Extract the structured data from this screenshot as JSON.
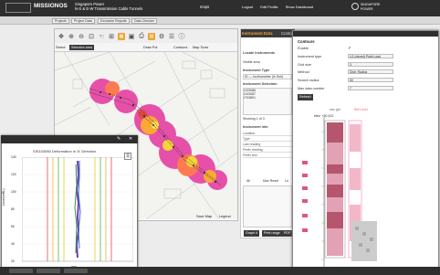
{
  "header": {
    "brand": "MISSIONOS",
    "sub1": "Singapore Power",
    "sub2": "N-S & E-W Transmission Cable Tunnels",
    "user": "mops",
    "links": [
      "Logout",
      "Edit Profile",
      "Show Dashboard"
    ],
    "partner1": "SINGAPORE",
    "partner2": "POWER"
  },
  "nav": [
    "Projects",
    "Project Data",
    "Exclusive Reports",
    "Data Checker"
  ],
  "toolbar": {
    "select": "Select",
    "selection_area": "Selection area",
    "draw": "Draw Poi",
    "contours": "Contours",
    "map_tools": "Map Tools",
    "save_map": "Save Map",
    "legend": "Legend"
  },
  "right": {
    "tab_a": "Instrument Data",
    "tab_b": "Contours",
    "locate": "Locate Instruments",
    "visible": "Visible area",
    "itype": "Instrument Type",
    "itype_val": "ID — Inclinometer (in Soil)",
    "isel": "Instrument Selection",
    "items": [
      "I103086",
      "I103087",
      "I703801"
    ],
    "showing": "Showing 1 of 3",
    "info": "Instrument Info",
    "fields": [
      "Location",
      "Type",
      "Last reading",
      "Prefix reading",
      "Prefix text"
    ],
    "tabs2": [
      "All",
      "Max Reset",
      "Lo"
    ],
    "btns": [
      "Graph it",
      "Print range",
      "PDF"
    ]
  },
  "contours": {
    "title": "Contours",
    "rows": [
      {
        "label": "Enable",
        "val": "✓"
      },
      {
        "label": "Instrument type",
        "val": "LG (mixed) Point Load"
      },
      {
        "label": "Grid size",
        "val": "3"
      },
      {
        "label": "Method",
        "val": "Distr. Radius"
      },
      {
        "label": "Search radius",
        "val": "50"
      },
      {
        "label": "Max data number",
        "val": "7"
      }
    ],
    "refresh": "Refresh",
    "col_a": "insc gid",
    "col_b": "Ref-Level",
    "top_label": "elev. +30.412"
  },
  "deform": {
    "title": "SIS103080 Deformation in 'A' Direction",
    "ylabel": "Level(mRL)",
    "xlabel": "mm",
    "yticks": [
      "140",
      "120",
      "100",
      "80",
      "60",
      "40",
      "20"
    ]
  }
}
